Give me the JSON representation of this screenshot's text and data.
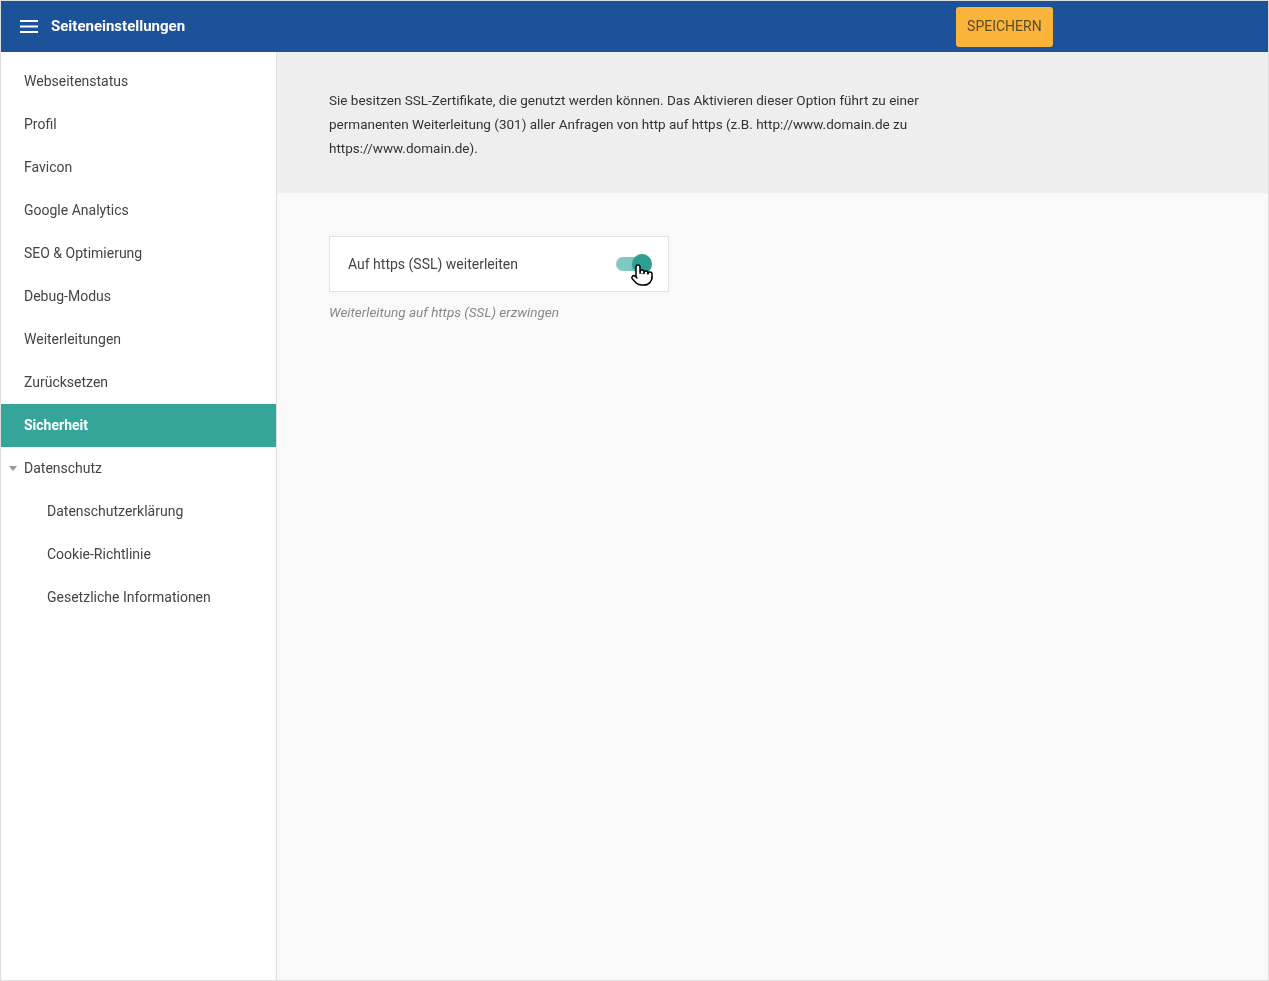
{
  "header": {
    "title": "Seiteneinstellungen",
    "save_button": "SPEICHERN"
  },
  "sidebar": {
    "items": [
      {
        "label": "Webseitenstatus",
        "selected": false
      },
      {
        "label": "Profil",
        "selected": false
      },
      {
        "label": "Favicon",
        "selected": false
      },
      {
        "label": "Google Analytics",
        "selected": false
      },
      {
        "label": "SEO & Optimierung",
        "selected": false
      },
      {
        "label": "Debug-Modus",
        "selected": false
      },
      {
        "label": "Weiterleitungen",
        "selected": false
      },
      {
        "label": "Zurücksetzen",
        "selected": false
      },
      {
        "label": "Sicherheit",
        "selected": true
      },
      {
        "label": "Datenschutz",
        "selected": false,
        "expanded": true,
        "children": [
          {
            "label": "Datenschutzerklärung",
            "selected": false
          },
          {
            "label": "Cookie-Richtlinie",
            "selected": false
          },
          {
            "label": "Gesetzliche Informationen",
            "selected": false
          }
        ]
      }
    ]
  },
  "info_text": "Sie besitzen SSL-Zertifikate, die genutzt werden können. Das Aktivieren dieser Option führt zu einer permanenten Weiterleitung (301) aller Anfragen von http auf https (z.B. http://www.domain.de zu https://www.domain.de).",
  "setting": {
    "label": "Auf https (SSL) weiterleiten",
    "on": true,
    "hint": "Weiterleitung auf https (SSL) erzwingen"
  }
}
